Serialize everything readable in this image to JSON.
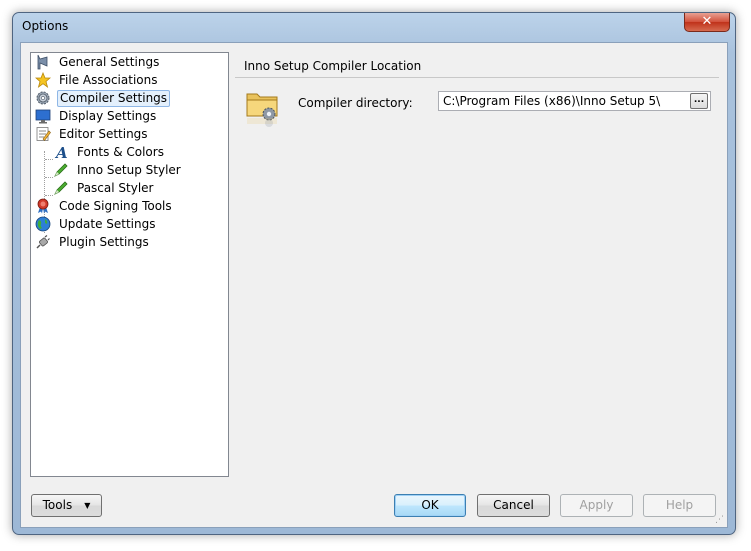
{
  "window": {
    "title": "Options",
    "close_label": "✕"
  },
  "tree": {
    "items": [
      {
        "label": "General Settings",
        "icon": "general-settings-icon",
        "level": 0
      },
      {
        "label": "File Associations",
        "icon": "star-icon",
        "level": 0
      },
      {
        "label": "Compiler Settings",
        "icon": "gear-icon",
        "level": 0,
        "selected": true
      },
      {
        "label": "Display Settings",
        "icon": "monitor-icon",
        "level": 0
      },
      {
        "label": "Editor Settings",
        "icon": "editor-icon",
        "level": 0
      },
      {
        "label": "Fonts & Colors",
        "icon": "font-icon",
        "level": 1
      },
      {
        "label": "Inno Setup Styler",
        "icon": "green-pen-icon",
        "level": 1
      },
      {
        "label": "Pascal Styler",
        "icon": "green-pen-icon",
        "level": 1
      },
      {
        "label": "Code Signing Tools",
        "icon": "ribbon-badge-icon",
        "level": 0
      },
      {
        "label": "Update Settings",
        "icon": "globe-icon",
        "level": 0
      },
      {
        "label": "Plugin Settings",
        "icon": "plug-icon",
        "level": 0
      }
    ]
  },
  "panel": {
    "section_title": "Inno Setup Compiler Location",
    "compiler_dir_label": "Compiler directory:",
    "compiler_dir_value": "C:\\Program Files (x86)\\Inno Setup 5\\",
    "browse_label": "..."
  },
  "footer": {
    "tools_label": "Tools",
    "ok_label": "OK",
    "cancel_label": "Cancel",
    "apply_label": "Apply",
    "help_label": "Help"
  }
}
